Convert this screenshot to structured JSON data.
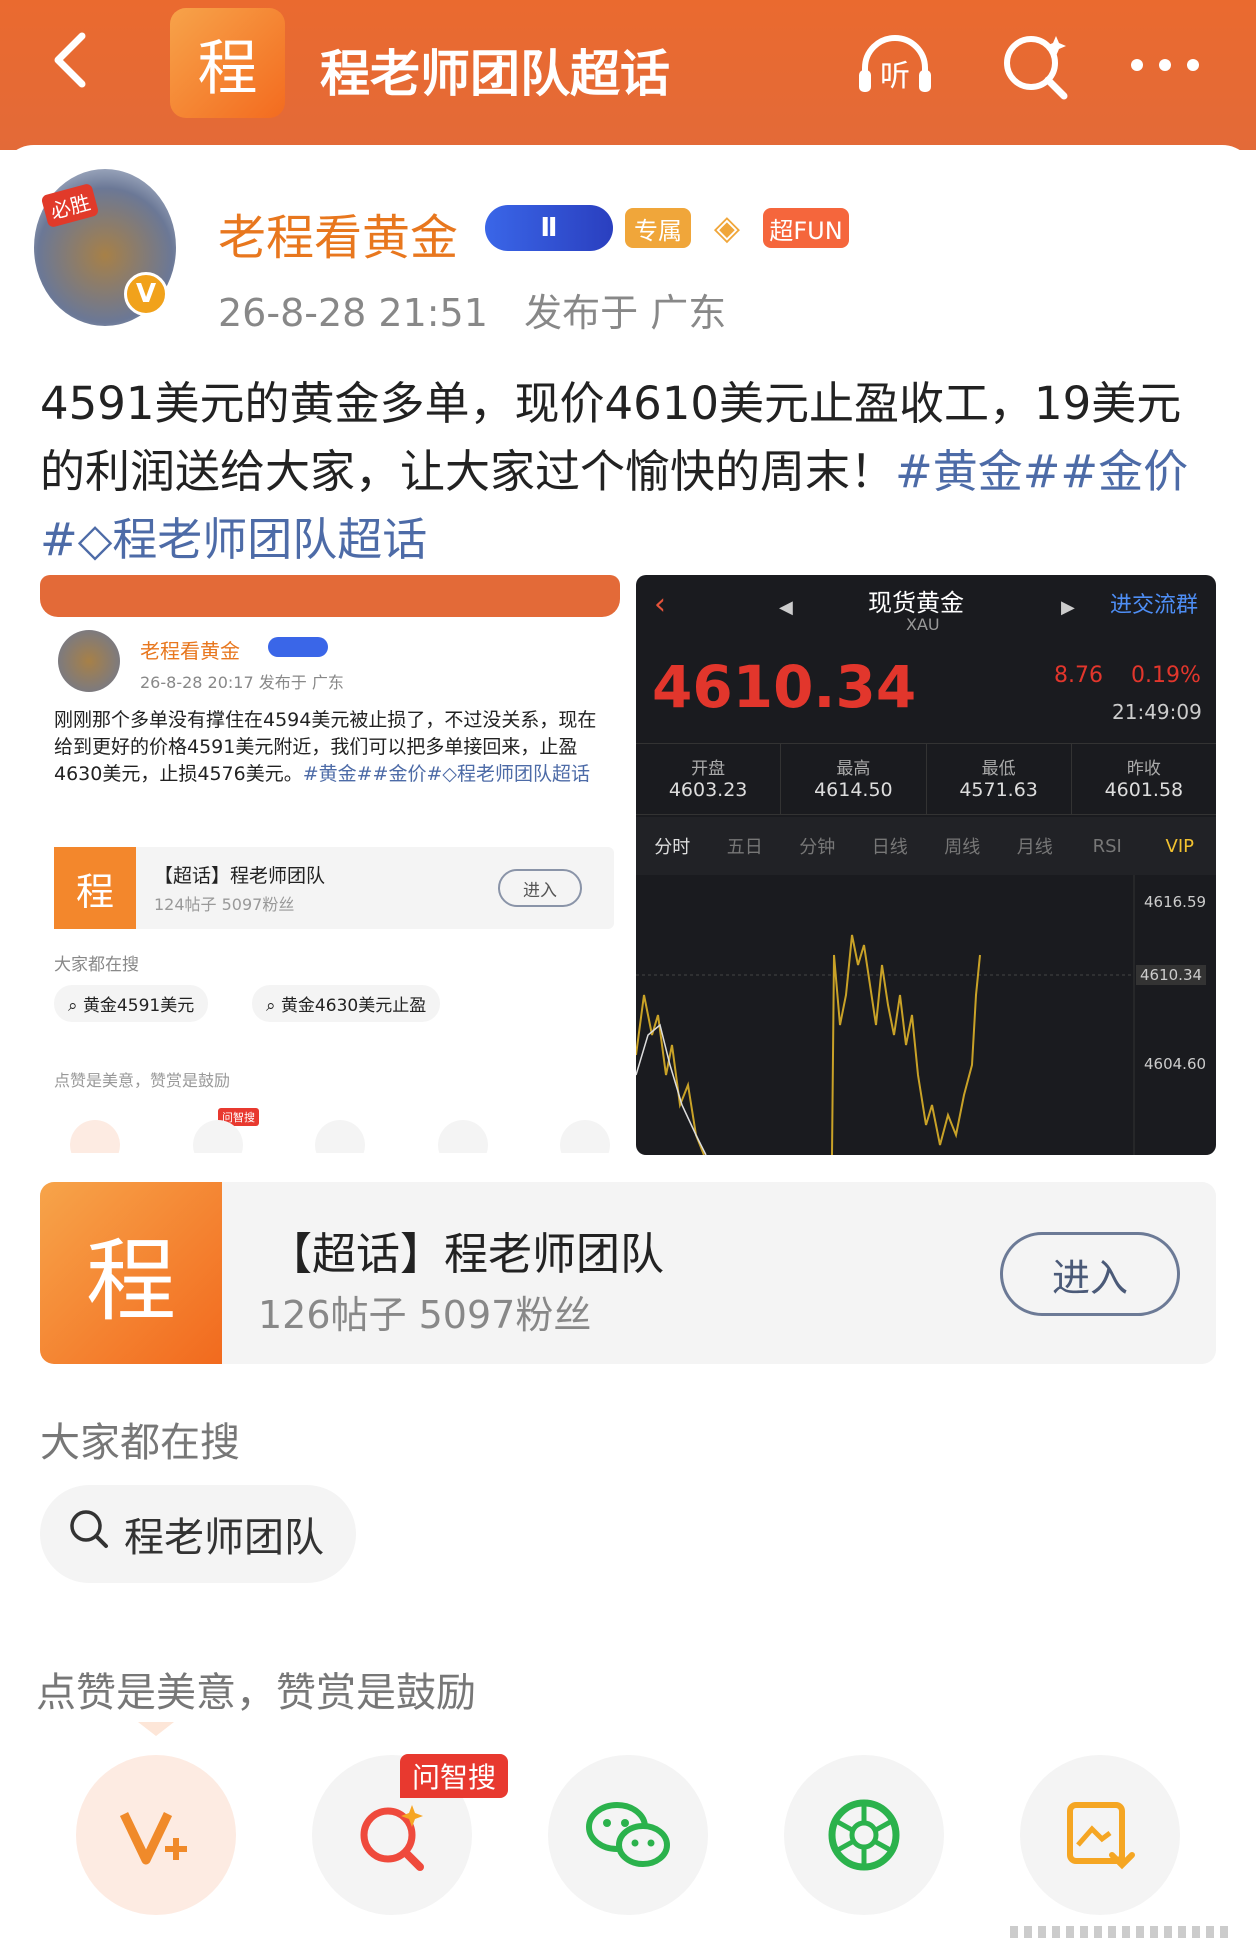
{
  "header": {
    "logo_char": "程",
    "title": "程老师团队超话"
  },
  "post": {
    "author": "老程看黄金",
    "avatar_tag": "必胜",
    "badge_whale": "Ⅱ",
    "badge_exclusive": "专属",
    "badge_fun": "超FUN",
    "time": "26-8-28 21:51",
    "location": "发布于 广东",
    "text": "4591美元的黄金多单，现价4610美元止盈收工，19美元的利润送给大家，让大家过个愉快的周末！",
    "tags": "#黄金##金价#◇程老师团队超话"
  },
  "shot1": {
    "author": "老程看黄金",
    "meta": "26-8-28 20:17  发布于 广东",
    "text": "刚刚那个多单没有撑住在4594美元被止损了，不过没关系，现在给到更好的价格4591美元附近，我们可以把多单接回来，止盈4630美元，止损4576美元。",
    "tags": "#黄金##金价#◇程老师团队超话",
    "card_logo": "程",
    "card_title": "【超话】程老师团队",
    "card_sub": "124帖子 5097粉丝",
    "card_btn": "进入",
    "search_label": "大家都在搜",
    "search1": "黄金4591美元",
    "search2": "黄金4630美元止盈",
    "likes": "点赞是美意，赞赏是鼓励",
    "wzs": "问智搜"
  },
  "shot2": {
    "title": "现货黄金",
    "code": "XAU",
    "join": "进交流群",
    "price": "4610.34",
    "change": "8.76",
    "pct": "0.19%",
    "clock": "21:49:09",
    "stats": [
      {
        "label": "开盘",
        "value": "4603.23"
      },
      {
        "label": "最高",
        "value": "4614.50"
      },
      {
        "label": "最低",
        "value": "4571.63"
      },
      {
        "label": "昨收",
        "value": "4601.58"
      }
    ],
    "tabs": [
      "分时",
      "五日",
      "分钟",
      "日线",
      "周线",
      "月线",
      "RSI",
      "VIP"
    ],
    "axis": [
      "4616.59",
      "4610.34",
      "4604.60"
    ]
  },
  "topic_card": {
    "logo_char": "程",
    "title": "【超话】程老师团队",
    "stats": "126帖子 5097粉丝",
    "button": "进入"
  },
  "search_section": {
    "label": "大家都在搜",
    "query": "程老师团队"
  },
  "likes_text": "点赞是美意，赞赏是鼓励",
  "wzs_badge": "问智搜",
  "colors": {
    "brand": "#e36a38",
    "link": "#4d6ba7",
    "gold": "#e8771e"
  }
}
